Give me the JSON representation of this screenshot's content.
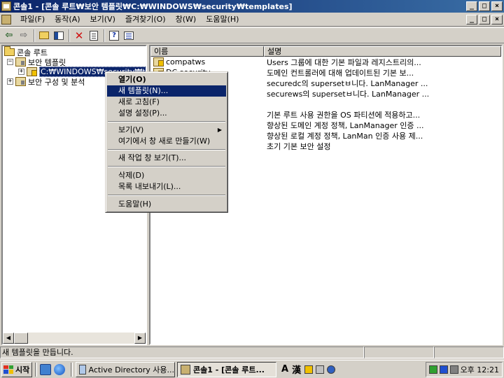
{
  "window": {
    "title": "콘솔1 - [콘솔 루트₩보안 템플릿₩C:₩WINDOWS₩security₩templates]",
    "app_icon": "mmc-console-icon",
    "controls": [
      "_",
      "□",
      "×"
    ]
  },
  "menubar": {
    "items": [
      "파일(F)",
      "동작(A)",
      "보기(V)",
      "즐겨찾기(O)",
      "창(W)",
      "도움말(H)"
    ],
    "child_controls": [
      "_",
      "□",
      "×"
    ]
  },
  "toolbar": {
    "buttons": [
      "back-arrow-icon",
      "forward-arrow-icon",
      "up-folder-icon",
      "show-hide-tree-icon",
      "delete-icon",
      "properties-icon",
      "help-icon",
      "export-list-icon"
    ]
  },
  "tree": {
    "root": "콘솔 루트",
    "security_templates": "보안 템플릿",
    "templates_path": "C:₩WINDOWS₩security₩tem",
    "security_config": "보안 구성 및 분석"
  },
  "list": {
    "columns": [
      "이름",
      "설명"
    ],
    "rows": [
      {
        "name": "compatws",
        "desc": "Users 그룹에 대한 기본 파일과 레지스트리의..."
      },
      {
        "name": "DC security",
        "desc": "도메인 컨트롤러에 대해 업데이트된 기본 보..."
      },
      {
        "name": "",
        "desc": "securedc의 supersetㅂ니다. LanManager ..."
      },
      {
        "name": "",
        "desc": "securews의 supersetㅂ니다. LanManager ..."
      },
      {
        "name": "",
        "desc": ""
      },
      {
        "name": "",
        "desc": "기본 루트 사용 권한을 OS 파티션에 적용하고..."
      },
      {
        "name": "",
        "desc": "향상된 도메인 계정 정책, LanManager 인증 ..."
      },
      {
        "name": "",
        "desc": "향상된 로컬 계정 정책, LanMan 인증 사용 제..."
      },
      {
        "name": "",
        "desc": "초기 기본 보안 설정"
      }
    ]
  },
  "context_menu": {
    "items": [
      {
        "label": "열기(O)",
        "bold": true
      },
      {
        "label": "새 템플릿(N)...",
        "highlighted": true
      },
      {
        "label": "새로 고침(F)"
      },
      {
        "label": "설명 설정(P)..."
      },
      {
        "label": "보기(V)",
        "submenu": true
      },
      {
        "label": "여기에서 창 새로 만들기(W)"
      },
      {
        "label": "새 작업 창 보기(T)..."
      },
      {
        "label": "삭제(D)"
      },
      {
        "label": "목록 내보내기(L)..."
      },
      {
        "label": "도움말(H)"
      }
    ],
    "submenu_arrow": "▶"
  },
  "statusbar": {
    "text": "새 템플릿을 만듭니다."
  },
  "taskbar": {
    "start": "시작",
    "tasks": [
      {
        "label": "Active Directory 사용..."
      },
      {
        "label": "콘솔1 - [콘솔 루트..."
      }
    ],
    "ime": [
      "A",
      "漢"
    ],
    "clock": "오후 12:21"
  },
  "colors": {
    "titlebar_start": "#0a246a",
    "titlebar_end": "#3a6ea5",
    "highlight": "#0a246a",
    "face": "#d4d0c8"
  }
}
